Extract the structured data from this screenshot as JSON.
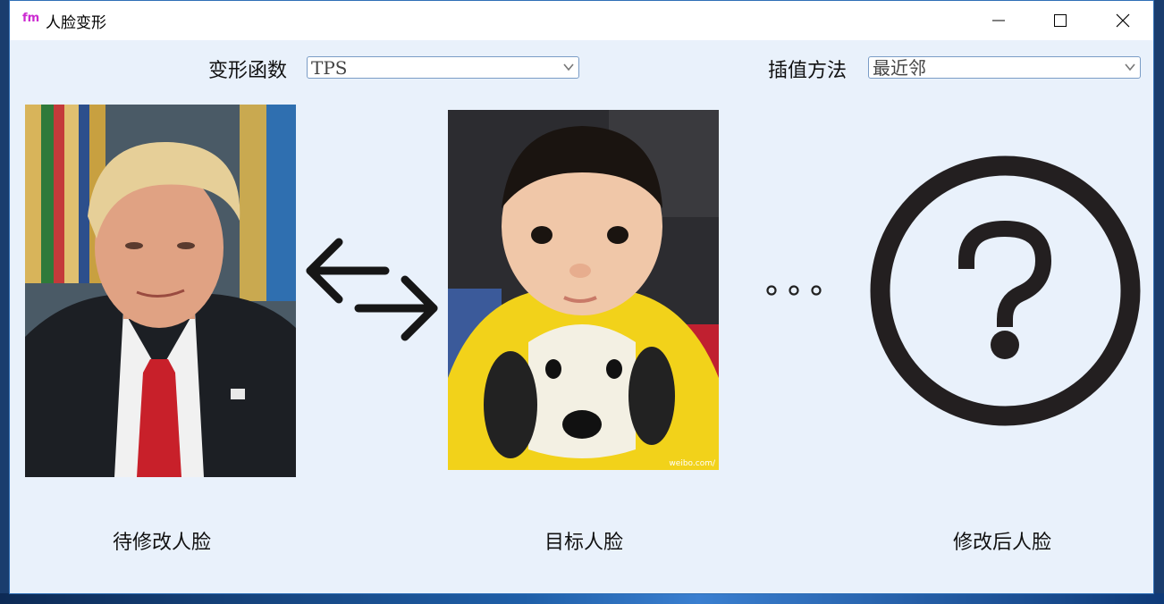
{
  "window": {
    "app_icon_text": "fm",
    "title": "人脸变形"
  },
  "controls": {
    "warp_label": "变形函数",
    "warp_value": "TPS",
    "interp_label": "插值方法",
    "interp_value": "最近邻"
  },
  "images": {
    "source_caption": "待修改人脸",
    "target_caption": "目标人脸",
    "result_caption": "修改后人脸",
    "target_watermark": "weibo.com/"
  },
  "icons": {
    "swap": "swap-arrows-icon",
    "ellipsis": "ellipsis-icon",
    "unknown": "question-circle-icon"
  },
  "colors": {
    "window_bg": "#e9f1fb",
    "app_icon": "#cc2ad1",
    "shirt_yellow": "#f2d21a",
    "tie_red": "#c8202a"
  }
}
